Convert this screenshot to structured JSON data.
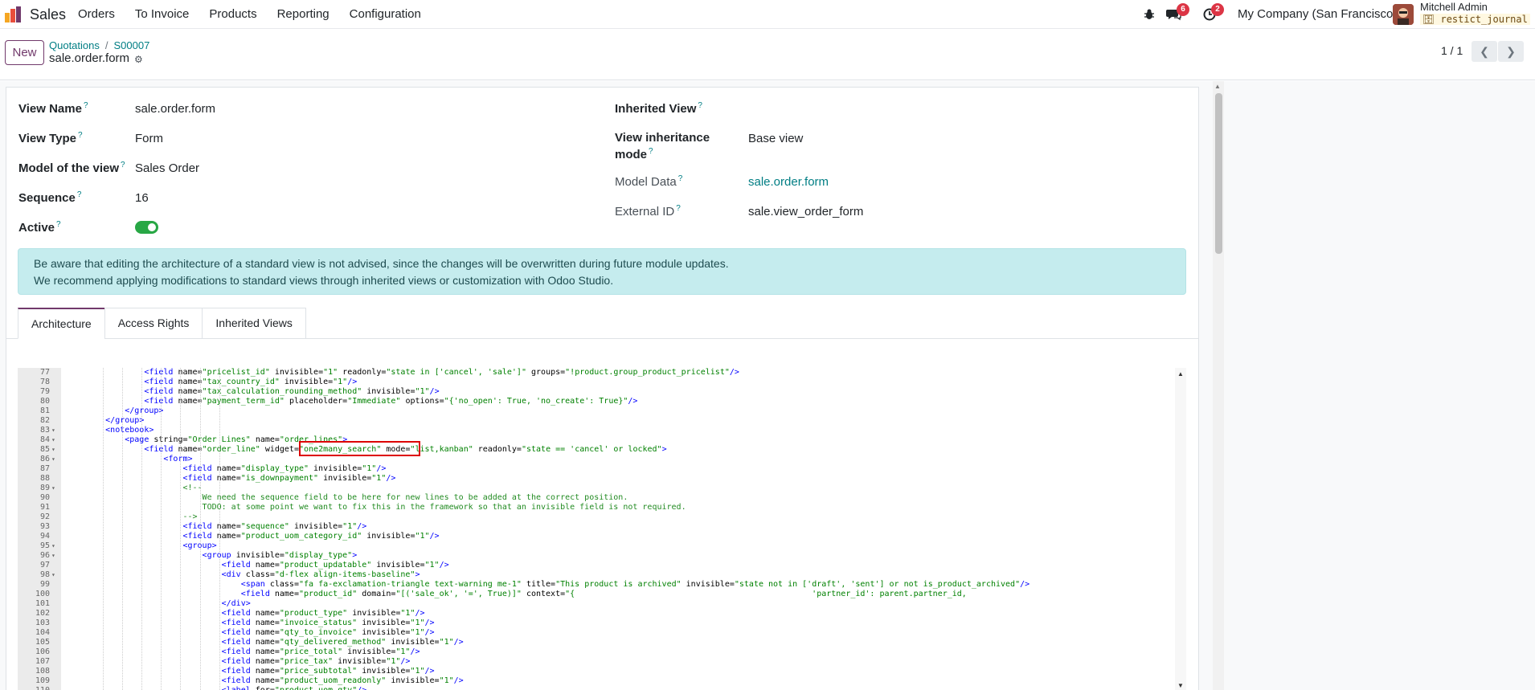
{
  "navbar": {
    "app_name": "Sales",
    "menu": [
      "Orders",
      "To Invoice",
      "Products",
      "Reporting",
      "Configuration"
    ],
    "messages_count": "6",
    "activities_count": "2",
    "company": "My Company (San Francisco)",
    "user_name": "Mitchell Admin",
    "database": "restict_journal"
  },
  "control_panel": {
    "new_label": "New",
    "breadcrumb": [
      "Quotations",
      "S00007"
    ],
    "record_title": "sale.order.form",
    "pager": "1 / 1"
  },
  "form": {
    "view_name_label": "View Name",
    "view_name": "sale.order.form",
    "view_type_label": "View Type",
    "view_type": "Form",
    "model_label": "Model of the view",
    "model": "Sales Order",
    "sequence_label": "Sequence",
    "sequence": "16",
    "active_label": "Active",
    "active": true,
    "inherited_view_label": "Inherited View",
    "inheritance_mode_label_1": "View inheritance",
    "inheritance_mode_label_2": "mode",
    "inheritance_mode": "Base view",
    "model_data_label": "Model Data",
    "model_data": "sale.order.form",
    "external_id_label": "External ID",
    "external_id": "sale.view_order_form",
    "help_marker": "?"
  },
  "alert": {
    "line1": "Be aware that editing the architecture of a standard view is not advised, since the changes will be overwritten during future module updates.",
    "line2": "We recommend applying modifications to standard views through inherited views or customization with Odoo Studio."
  },
  "tabs": [
    "Architecture",
    "Access Rights",
    "Inherited Views"
  ],
  "code": {
    "lines": [
      {
        "n": "77",
        "fold": "",
        "indent": 16,
        "text": "<field name=\"pricelist_id\" invisible=\"1\" readonly=\"state in ['cancel', 'sale']\" groups=\"!product.group_product_pricelist\"/>"
      },
      {
        "n": "78",
        "fold": "",
        "indent": 16,
        "text": "<field name=\"tax_country_id\" invisible=\"1\"/>"
      },
      {
        "n": "79",
        "fold": "",
        "indent": 16,
        "text": "<field name=\"tax_calculation_rounding_method\" invisible=\"1\"/>"
      },
      {
        "n": "80",
        "fold": "",
        "indent": 16,
        "text": "<field name=\"payment_term_id\" placeholder=\"Immediate\" options=\"{'no_open': True, 'no_create': True}\"/>"
      },
      {
        "n": "81",
        "fold": "",
        "indent": 12,
        "text": "</group>"
      },
      {
        "n": "82",
        "fold": "",
        "indent": 8,
        "text": "</group>"
      },
      {
        "n": "83",
        "fold": "▾",
        "indent": 8,
        "text": "<notebook>"
      },
      {
        "n": "84",
        "fold": "▾",
        "indent": 12,
        "text": "<page string=\"Order Lines\" name=\"order_lines\">"
      },
      {
        "n": "85",
        "fold": "▾",
        "indent": 16,
        "text": "<field name=\"order_line\" widget=\"one2many_search\" mode=\"list,kanban\" readonly=\"state == 'cancel' or locked\">"
      },
      {
        "n": "86",
        "fold": "▾",
        "indent": 20,
        "text": "<form>"
      },
      {
        "n": "87",
        "fold": "",
        "indent": 24,
        "text": "<field name=\"display_type\" invisible=\"1\"/>"
      },
      {
        "n": "88",
        "fold": "",
        "indent": 24,
        "text": "<field name=\"is_downpayment\" invisible=\"1\"/>"
      },
      {
        "n": "89",
        "fold": "▾",
        "indent": 24,
        "text": "<!--"
      },
      {
        "n": "90",
        "fold": "",
        "indent": 28,
        "text": "We need the sequence field to be here for new lines to be added at the correct position."
      },
      {
        "n": "91",
        "fold": "",
        "indent": 28,
        "text": "TODO: at some point we want to fix this in the framework so that an invisible field is not required."
      },
      {
        "n": "92",
        "fold": "",
        "indent": 24,
        "text": "-->"
      },
      {
        "n": "93",
        "fold": "",
        "indent": 24,
        "text": "<field name=\"sequence\" invisible=\"1\"/>"
      },
      {
        "n": "94",
        "fold": "",
        "indent": 24,
        "text": "<field name=\"product_uom_category_id\" invisible=\"1\"/>"
      },
      {
        "n": "95",
        "fold": "▾",
        "indent": 24,
        "text": "<group>"
      },
      {
        "n": "96",
        "fold": "▾",
        "indent": 28,
        "text": "<group invisible=\"display_type\">"
      },
      {
        "n": "97",
        "fold": "",
        "indent": 32,
        "text": "<field name=\"product_updatable\" invisible=\"1\"/>"
      },
      {
        "n": "98",
        "fold": "▾",
        "indent": 32,
        "text": "<div class=\"d-flex align-items-baseline\">"
      },
      {
        "n": "99",
        "fold": "",
        "indent": 36,
        "text": "<span class=\"fa fa-exclamation-triangle text-warning me-1\" title=\"This product is archived\" invisible=\"state not in ['draft', 'sent'] or not is_product_archived\"/>"
      },
      {
        "n": "100",
        "fold": "",
        "indent": 36,
        "text": "<field name=\"product_id\" domain=\"[('sale_ok', '=', True)]\" context=\"{                                                 'partner_id': parent.partner_id,"
      },
      {
        "n": "101",
        "fold": "",
        "indent": 32,
        "text": "</div>"
      },
      {
        "n": "102",
        "fold": "",
        "indent": 32,
        "text": "<field name=\"product_type\" invisible=\"1\"/>"
      },
      {
        "n": "103",
        "fold": "",
        "indent": 32,
        "text": "<field name=\"invoice_status\" invisible=\"1\"/>"
      },
      {
        "n": "104",
        "fold": "",
        "indent": 32,
        "text": "<field name=\"qty_to_invoice\" invisible=\"1\"/>"
      },
      {
        "n": "105",
        "fold": "",
        "indent": 32,
        "text": "<field name=\"qty_delivered_method\" invisible=\"1\"/>"
      },
      {
        "n": "106",
        "fold": "",
        "indent": 32,
        "text": "<field name=\"price_total\" invisible=\"1\"/>"
      },
      {
        "n": "107",
        "fold": "",
        "indent": 32,
        "text": "<field name=\"price_tax\" invisible=\"1\"/>"
      },
      {
        "n": "108",
        "fold": "",
        "indent": 32,
        "text": "<field name=\"price_subtotal\" invisible=\"1\"/>"
      },
      {
        "n": "109",
        "fold": "",
        "indent": 32,
        "text": "<field name=\"product_uom_readonly\" invisible=\"1\"/>"
      },
      {
        "n": "110",
        "fold": "",
        "indent": 32,
        "text": "<label for=\"product_uom_qty\"/>"
      }
    ],
    "colors": {
      "tag": "#0000ff",
      "attr": "#000000",
      "string": "#008000",
      "comment": "#228b22"
    }
  }
}
